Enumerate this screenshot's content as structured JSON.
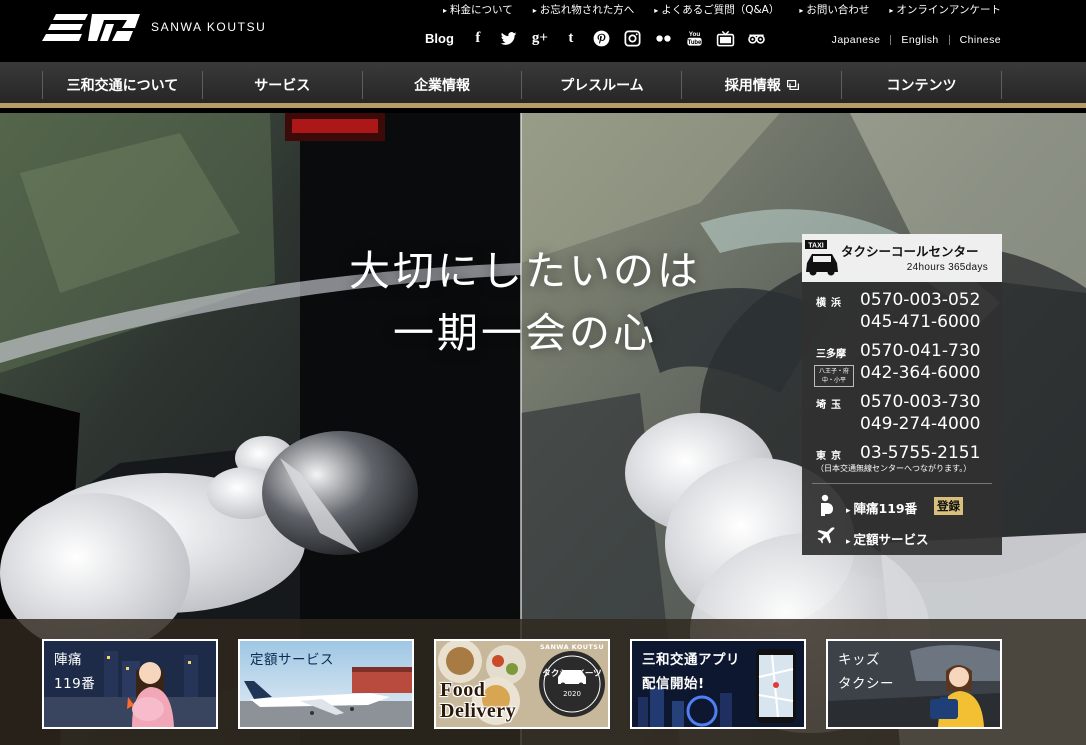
{
  "brand": {
    "logo_text": "三和",
    "name": "SANWA KOUTSU"
  },
  "utility_links": [
    {
      "label": "料金について"
    },
    {
      "label": "お忘れ物された方へ"
    },
    {
      "label": "よくあるご質問（Q&A）"
    },
    {
      "label": "お問い合わせ"
    },
    {
      "label": "オンラインアンケート"
    }
  ],
  "social": {
    "blog_label": "Blog",
    "icons": [
      {
        "icon": "facebook-icon",
        "glyph": "f"
      },
      {
        "icon": "twitter-icon",
        "glyph": ""
      },
      {
        "icon": "google-plus-icon",
        "glyph": "g+"
      },
      {
        "icon": "tumblr-icon",
        "glyph": "t"
      },
      {
        "icon": "pinterest-icon",
        "glyph": ""
      },
      {
        "icon": "instagram-icon",
        "glyph": ""
      },
      {
        "icon": "flickr-icon",
        "glyph": ""
      },
      {
        "icon": "youtube-icon",
        "glyph": ""
      },
      {
        "icon": "tv-icon",
        "glyph": ""
      },
      {
        "icon": "tripadvisor-icon",
        "glyph": ""
      }
    ]
  },
  "languages": [
    {
      "label": "Japanese"
    },
    {
      "label": "English"
    },
    {
      "label": "Chinese"
    }
  ],
  "nav": [
    {
      "label": "三和交通について"
    },
    {
      "label": "サービス"
    },
    {
      "label": "企業情報"
    },
    {
      "label": "プレスルーム"
    },
    {
      "label": "採用情報",
      "external": true
    },
    {
      "label": "コンテンツ"
    }
  ],
  "hero": {
    "line1": "大切にしたいのは",
    "line2": "一期一会の心"
  },
  "call_center": {
    "taxi_tag": "TAXI",
    "title": "タクシーコールセンター",
    "hours": "24hours 365days",
    "regions": [
      {
        "label": "横浜",
        "sub": "",
        "phones": [
          "0570-003-052",
          "045-471-6000"
        ]
      },
      {
        "label": "三多摩",
        "sub": "八王子・府中・小平",
        "phones": [
          "0570-041-730",
          "042-364-6000"
        ]
      },
      {
        "label": "埼玉",
        "sub": "",
        "phones": [
          "0570-003-730",
          "049-274-4000"
        ]
      },
      {
        "label": "東京",
        "sub": "",
        "phones": [
          "03-5755-2151"
        ]
      }
    ],
    "tokyo_note": "（日本交通無線センターへつながります。）",
    "link1_label": "陣痛119番",
    "link1_badge": "登録",
    "link2_label": "定額サービス"
  },
  "banners": [
    {
      "title": "陣痛",
      "subtitle": "119番"
    },
    {
      "title": "定額サービス",
      "subtitle": ""
    },
    {
      "title": "Food",
      "subtitle": "Delivery",
      "seal_top": "SANWA KOUTSU",
      "seal_mid": "タクシーイーツ",
      "seal_year": "2020"
    },
    {
      "title": "三和交通アプリ",
      "subtitle": "配信開始!"
    },
    {
      "title": "キッズ",
      "subtitle": "タクシー"
    }
  ],
  "colors": {
    "accent_gold": "#b89c66",
    "badge_gold": "#d8bf7c",
    "nav_bg": "#2e2e2e"
  }
}
